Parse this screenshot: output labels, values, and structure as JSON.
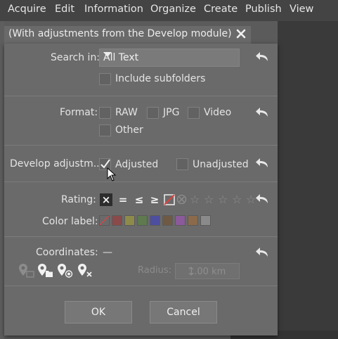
{
  "menubar": {
    "items": [
      "Acquire",
      "Edit",
      "Information",
      "Organize",
      "Create",
      "Publish",
      "View"
    ]
  },
  "tab": {
    "label": "(With adjustments from the Develop module)",
    "close_icon": "close-icon"
  },
  "dialog": {
    "search": {
      "label": "Search in:",
      "selected": "All Text",
      "include_subfolders_label": "Include subfolders",
      "include_subfolders_checked": false
    },
    "format": {
      "label": "Format:",
      "options": [
        {
          "label": "RAW",
          "checked": false
        },
        {
          "label": "JPG",
          "checked": false
        },
        {
          "label": "Video",
          "checked": false
        },
        {
          "label": "Other",
          "checked": false
        }
      ]
    },
    "develop": {
      "label": "Develop adjustm...",
      "adjusted_label": "Adjusted",
      "adjusted_checked": true,
      "unadjusted_label": "Unadjusted",
      "unadjusted_checked": false
    },
    "rating": {
      "label": "Rating:",
      "operators": [
        "×",
        "=",
        "≤",
        "≥"
      ],
      "stars": 5,
      "selected_stars": 0
    },
    "color_label": {
      "label": "Color label:",
      "swatches": [
        "#6a6a6a",
        "#8a4a4a",
        "#8e8a4a",
        "#5e7a4e",
        "#4e4ea0",
        "#6e5a44",
        "#8a5a9a",
        "#8a6a4a",
        "#8a8a8a"
      ]
    },
    "coordinates": {
      "label": "Coordinates:",
      "value": "—",
      "radius_label": "Radius:",
      "radius_value": "1.00 km"
    },
    "buttons": {
      "ok": "OK",
      "cancel": "Cancel"
    }
  },
  "colors": {
    "menubar_bg": "#444444",
    "dialog_bg": "#6a6a6a",
    "text": "#e4e4e4"
  }
}
